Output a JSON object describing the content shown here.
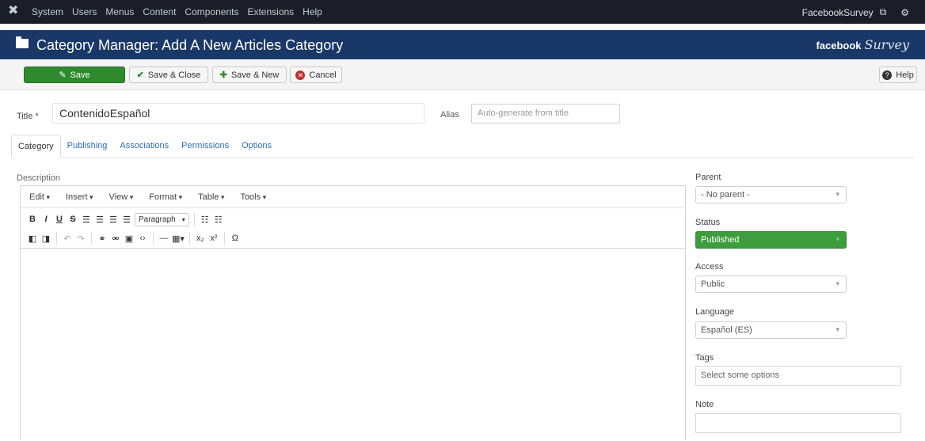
{
  "topnav": {
    "menu": [
      "System",
      "Users",
      "Menus",
      "Content",
      "Components",
      "Extensions",
      "Help"
    ],
    "site_name": "FacebookSurvey"
  },
  "header": {
    "title": "Category Manager: Add A New Articles Category",
    "brand_bold": "facebook",
    "brand_script": "Survey"
  },
  "toolbar": {
    "save": "Save",
    "save_close": "Save & Close",
    "save_new": "Save & New",
    "cancel": "Cancel",
    "help": "Help"
  },
  "form": {
    "title_label": "Title *",
    "title_value": "ContenidoEspañol",
    "alias_label": "Alias",
    "alias_placeholder": "Auto-generate from title"
  },
  "tabs": [
    "Category",
    "Publishing",
    "Associations",
    "Permissions",
    "Options"
  ],
  "editor": {
    "label": "Description",
    "menus": [
      "Edit",
      "Insert",
      "View",
      "Format",
      "Table",
      "Tools"
    ],
    "format_select": "Paragraph"
  },
  "sidebar": {
    "parent_label": "Parent",
    "parent_value": "- No parent -",
    "status_label": "Status",
    "status_value": "Published",
    "access_label": "Access",
    "access_value": "Public",
    "language_label": "Language",
    "language_value": "Español (ES)",
    "tags_label": "Tags",
    "tags_placeholder": "Select some options",
    "note_label": "Note"
  },
  "colors": {
    "topnav_bg": "#1b1e28",
    "subhead_bg": "#1a3867",
    "save_green": "#2f8a2e",
    "status_green": "#3d9c3c",
    "link_blue": "#2d6db5"
  }
}
